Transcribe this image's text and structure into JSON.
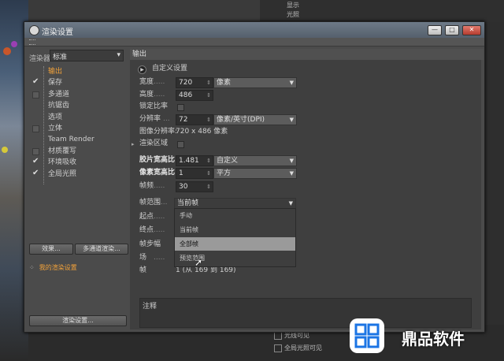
{
  "background": {
    "top_items": [
      "显示",
      "光照"
    ],
    "bottom_items": [
      "光线可见",
      "全局光照可见"
    ]
  },
  "dialog": {
    "title": "渲染设置",
    "window_buttons": {
      "minimize": "—",
      "maximize": "□",
      "close": "✕"
    }
  },
  "left": {
    "renderer_label": "渲染器",
    "renderer_value": "标准",
    "tree": [
      {
        "label": "输出",
        "checked": null,
        "active": true
      },
      {
        "label": "保存",
        "checked": true,
        "active": false
      },
      {
        "label": "多通道",
        "checked": false,
        "active": false
      },
      {
        "label": "抗锯齿",
        "checked": null,
        "active": false
      },
      {
        "label": "选项",
        "checked": null,
        "active": false
      },
      {
        "label": "立体",
        "checked": false,
        "active": false
      },
      {
        "label": "Team Render",
        "checked": null,
        "active": false
      },
      {
        "label": "材质覆写",
        "checked": false,
        "active": false
      },
      {
        "label": "环境吸收",
        "checked": true,
        "active": false
      },
      {
        "label": "全局光照",
        "checked": true,
        "active": false
      }
    ],
    "effects_button": "效果...",
    "multipass_button": "多通道渲染...",
    "save_item": "我的渲染设置",
    "render_settings_button": "渲染设置..."
  },
  "right": {
    "section_title": "输出",
    "custom_settings": "自定义设置",
    "width": {
      "label": "宽度",
      "value": "720",
      "unit": "像素"
    },
    "height": {
      "label": "高度",
      "value": "486"
    },
    "lock_ratio": {
      "label": "锁定比率"
    },
    "resolution": {
      "label": "分辨率",
      "value": "72",
      "unit": "像素/英寸(DPI)"
    },
    "image_resolution": {
      "label": "图像分辨率:",
      "value": "720 x 486 像素"
    },
    "render_region": {
      "label": "渲染区域"
    },
    "film_aspect": {
      "label": "胶片宽高比",
      "value": "1.481",
      "preset": "自定义"
    },
    "pixel_aspect": {
      "label": "像素宽高比",
      "value": "1",
      "preset": "平方"
    },
    "fps": {
      "label": "帧频",
      "value": "30"
    },
    "frame_range": {
      "label": "帧范围",
      "value": "当前帧"
    },
    "start": {
      "label": "起点"
    },
    "end": {
      "label": "终点"
    },
    "frame_step": {
      "label": "帧步幅"
    },
    "fields": {
      "label": "场"
    },
    "frames": {
      "label": "帧",
      "value": "1 (从 169 到 169)"
    },
    "menu_options": [
      "手动",
      "当前帧",
      "全部帧",
      "预览范围"
    ],
    "menu_highlight_index": 2,
    "notes_label": "注释"
  },
  "watermark": {
    "text": "鼎品软件"
  }
}
